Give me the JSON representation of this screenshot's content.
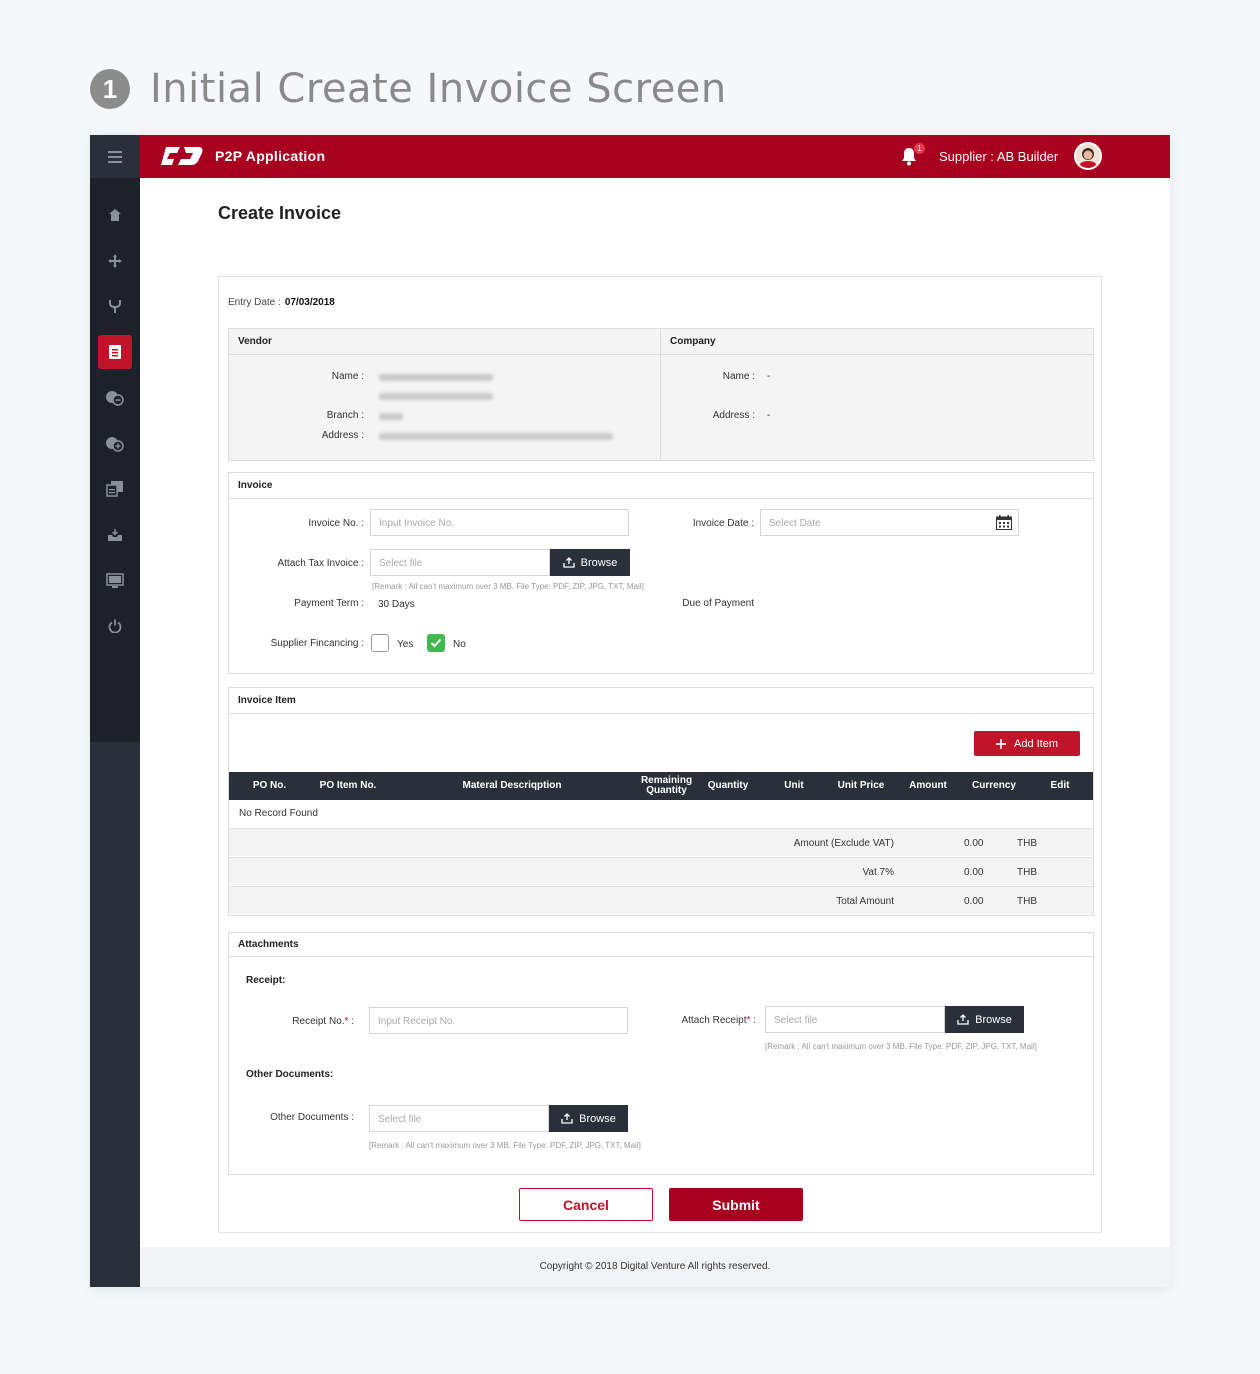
{
  "page_heading": {
    "step": "1",
    "text": "Initial Create Invoice Screen"
  },
  "topbar": {
    "app_name": "P2P Application",
    "notification_count": "1",
    "supplier_label": "Supplier : AB Builder"
  },
  "sidebar": {
    "items": [
      {
        "icon": "home-icon"
      },
      {
        "icon": "move-icon"
      },
      {
        "icon": "fork-icon"
      },
      {
        "icon": "invoice-icon",
        "active": true
      },
      {
        "icon": "coins-minus-icon"
      },
      {
        "icon": "coins-plus-icon"
      },
      {
        "icon": "document-edit-icon"
      },
      {
        "icon": "inbox-icon"
      },
      {
        "icon": "monitor-icon"
      },
      {
        "icon": "power-icon"
      }
    ]
  },
  "main": {
    "title": "Create Invoice",
    "entry_date_label": "Entry Date :",
    "entry_date": "07/03/2018"
  },
  "vendor": {
    "header": "Vendor",
    "name_label": "Name :",
    "branch_label": "Branch :",
    "address_label": "Address :"
  },
  "company": {
    "header": "Company",
    "name_label": "Name :",
    "name_value": "-",
    "address_label": "Address :",
    "address_value": "-"
  },
  "invoice": {
    "header": "Invoice",
    "invoice_no_label": "Invoice No. :",
    "invoice_no_placeholder": "Input Invoice No.",
    "invoice_date_label": "Invoice Date :",
    "invoice_date_placeholder": "Select Date",
    "attach_tax_label": "Attach Tax Invoice :",
    "attach_tax_placeholder": "Select file",
    "browse_label": "Browse",
    "remark": "[Remark : All can't maximum over 3 MB. File Type: PDF, ZIP, JPG, TXT, Mail]",
    "payment_term_label": "Payment Term :",
    "payment_term_value": "30 Days",
    "due_of_payment_label": "Due of Payment",
    "supplier_financing_label": "Supplier Fincancing :",
    "yes_label": "Yes",
    "no_label": "No"
  },
  "invoice_item": {
    "header": "Invoice Item",
    "add_item_label": "Add Item",
    "columns": [
      "PO No.",
      "PO Item No.",
      "Materal Descriqption",
      "Remaining Quantity",
      "Quantity",
      "Unit",
      "Unit Price",
      "Amount",
      "Currency",
      "Edit"
    ],
    "empty_text": "No Record Found",
    "summary": [
      {
        "label": "Amount (Exclude VAT)",
        "value": "0.00",
        "currency": "THB"
      },
      {
        "label": "Vat 7%",
        "value": "0.00",
        "currency": "THB"
      },
      {
        "label": "Total Amount",
        "value": "0.00",
        "currency": "THB"
      }
    ]
  },
  "attachments": {
    "header": "Attachments",
    "receipt_heading": "Receipt:",
    "receipt_no_label": "Receipt No.",
    "required_mark": "*",
    "label_suffix": " :",
    "receipt_no_placeholder": "Input Receipt No.",
    "attach_receipt_label": "Attach Receipt",
    "attach_receipt_placeholder": "Select file",
    "browse_label": "Browse",
    "remark": "[Remark : All can't maximum over 3 MB. File Type: PDF, ZIP, JPG, TXT, Mail]",
    "other_heading": "Other Documents:",
    "other_label": "Other Documents :",
    "other_placeholder": "Select file"
  },
  "actions": {
    "cancel_label": "Cancel",
    "submit_label": "Submit"
  },
  "footer": {
    "copyright": "Copyright © 2018 Digital Venture All rights reserved."
  },
  "colors": {
    "brand": "#a8001e",
    "accent": "#c0142a",
    "sidebar": "#1e2129",
    "success": "#3fb950"
  }
}
